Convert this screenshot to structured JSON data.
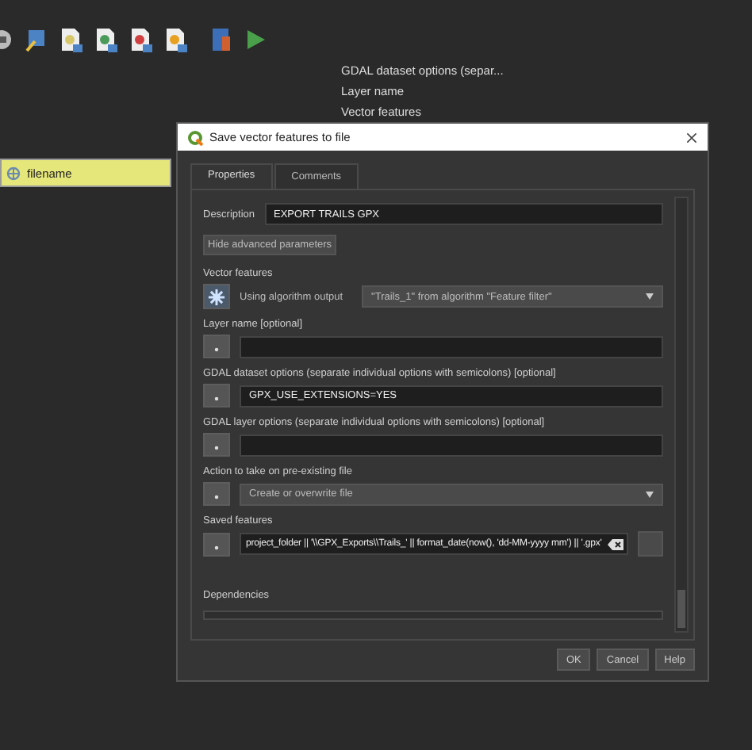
{
  "canvas": {
    "labels": [
      "GDAL dataset options (separ...",
      "Layer name",
      "Vector features"
    ],
    "node": {
      "label": "filename"
    }
  },
  "dialog": {
    "title": "Save vector features to file",
    "tabs": [
      {
        "label": "Properties",
        "selected": true
      },
      {
        "label": "Comments",
        "selected": false
      }
    ],
    "description": {
      "label": "Description",
      "value": "EXPORT TRAILS GPX"
    },
    "advanced_button": "Hide advanced parameters",
    "parameters": [
      {
        "kind": "algorithm",
        "label": "Vector features",
        "source": "Using algorithm output",
        "value": "\"Trails_1\" from algorithm \"Feature filter\""
      },
      {
        "kind": "text",
        "label": "Layer name [optional]"
      },
      {
        "kind": "text",
        "label": "GDAL dataset options (separate individual options with semicolons) [optional]",
        "value": "GPX_USE_EXTENSIONS=YES"
      },
      {
        "kind": "text",
        "label": "GDAL layer options (separate individual options with semicolons) [optional]"
      },
      {
        "kind": "choice",
        "label": "Action to take on pre-existing file",
        "value": "Create or overwrite file"
      },
      {
        "kind": "file",
        "label": "Saved features",
        "value": "project_folder || '\\\\GPX_Exports\\\\Trails_' || format_date(now(), 'dd-MM-yyyy mm') || '.gpx'"
      }
    ],
    "dependencies_label": "Dependencies",
    "buttons": [
      "OK",
      "Cancel",
      "Help"
    ]
  }
}
